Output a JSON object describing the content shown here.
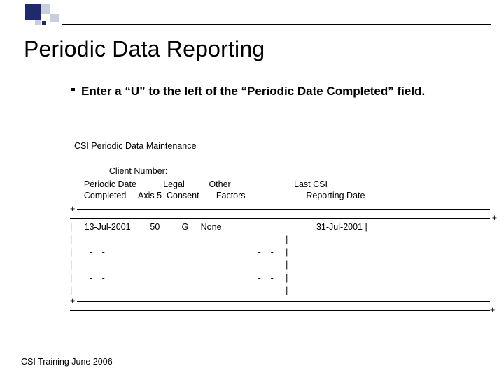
{
  "title": "Periodic Data Reporting",
  "bullet": "Enter a “U” to the left of the “Periodic Date Completed” field.",
  "screen": {
    "app_title": "CSI Periodic Data Maintenance",
    "client_number_label": "Client Number:",
    "header_line1": "    Periodic Date           Legal          Other                          Last CSI",
    "header_line2": "    Completed     Axis 5  Consent       Factors                         Reporting Date",
    "rows": [
      "|     13-Jul-2001        50         G     None                                       31-Jul-2001 |",
      "|       -    -                                                               -    -     |",
      "|       -    -                                                               -    -     |",
      "|       -    -                                                               -    -     |",
      "|       -    -                                                               -    -     |",
      "|       -    -                                                               -    -     |"
    ]
  },
  "footer": "CSI Training June 2006",
  "chart_data": {
    "type": "table",
    "title": "CSI Periodic Data Maintenance",
    "columns": [
      "Periodic Date Completed",
      "Axis 5",
      "Legal Consent",
      "Other Factors",
      "Last CSI Reporting Date"
    ],
    "rows": [
      [
        "13-Jul-2001",
        50,
        "G",
        "None",
        "31-Jul-2001"
      ],
      [
        "-  -",
        null,
        null,
        null,
        "-  -"
      ],
      [
        "-  -",
        null,
        null,
        null,
        "-  -"
      ],
      [
        "-  -",
        null,
        null,
        null,
        "-  -"
      ],
      [
        "-  -",
        null,
        null,
        null,
        "-  -"
      ],
      [
        "-  -",
        null,
        null,
        null,
        "-  -"
      ]
    ]
  }
}
